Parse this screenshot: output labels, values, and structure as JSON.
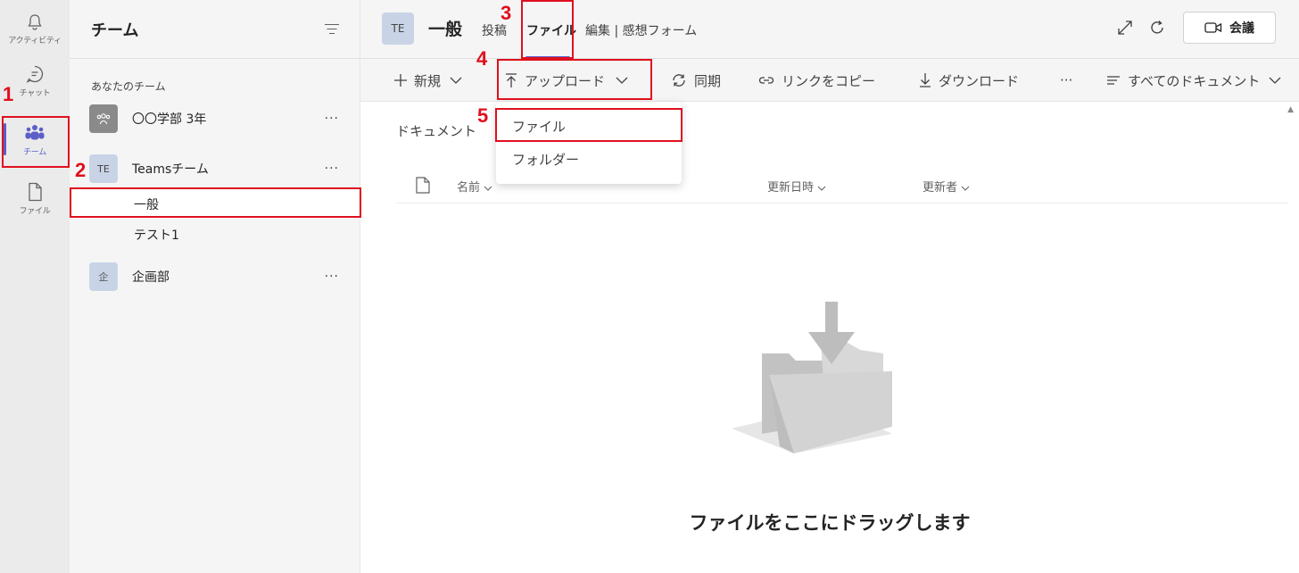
{
  "rail": {
    "items": [
      {
        "label": "アクティビティ",
        "icon": "bell-icon"
      },
      {
        "label": "チャット",
        "icon": "chat-icon"
      },
      {
        "label": "チーム",
        "icon": "teams-icon"
      },
      {
        "label": "ファイル",
        "icon": "file-icon"
      }
    ]
  },
  "panel": {
    "title": "チーム",
    "section_label": "あなたのチーム",
    "teams": [
      {
        "name": "〇〇学部 3年",
        "avatar": ""
      },
      {
        "name": "Teamsチーム",
        "avatar": "TE",
        "channels": [
          "一般",
          "テスト1"
        ]
      },
      {
        "name": "企画部",
        "avatar": "企"
      }
    ],
    "more": "···"
  },
  "header": {
    "avatar": "TE",
    "title": "一般",
    "tabs": [
      "投稿",
      "ファイル",
      "編集 | 感想フォーム"
    ],
    "meet_label": "会議"
  },
  "toolbar": {
    "new": "新規",
    "upload": "アップロード",
    "sync": "同期",
    "copy_link": "リンクをコピー",
    "download": "ダウンロード",
    "more": "···",
    "view": "すべてのドキュメント"
  },
  "content": {
    "breadcrumb": "ドキュメント",
    "columns": [
      "名前",
      "更新日時",
      "更新者"
    ],
    "empty_message": "ファイルをここにドラッグします"
  },
  "dropdown": {
    "items": [
      "ファイル",
      "フォルダー"
    ]
  },
  "annotations": [
    "1",
    "2",
    "3",
    "4",
    "5"
  ],
  "colors": {
    "accent": "#5b5fc7",
    "annotation": "#e0101e"
  }
}
